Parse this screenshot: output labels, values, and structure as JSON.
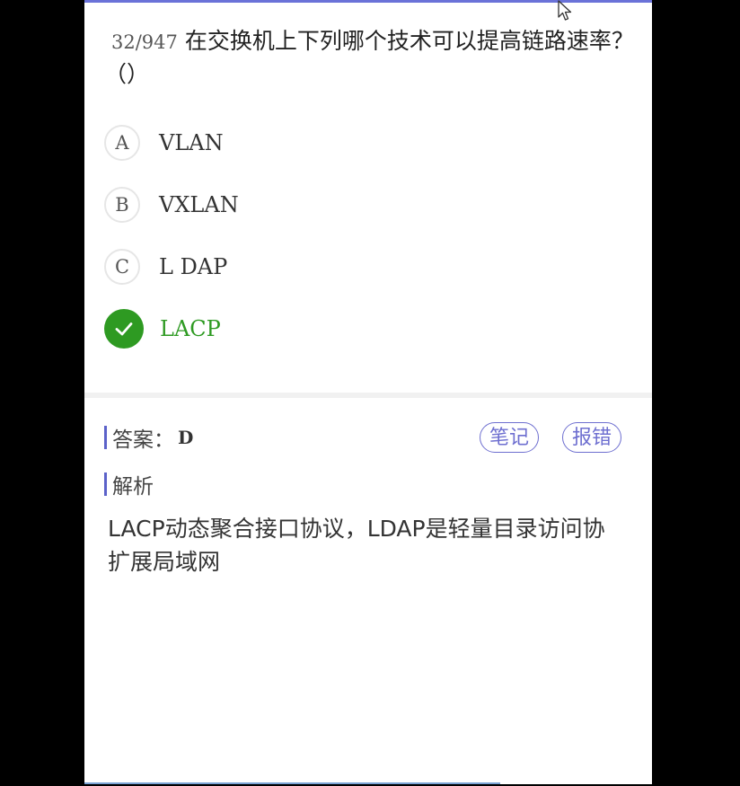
{
  "question": {
    "number": "32/947",
    "text": "在交换机上下列哪个技术可以提高链路速率？（）"
  },
  "options": [
    {
      "letter": "A",
      "text": "VLAN"
    },
    {
      "letter": "B",
      "text": "VXLAN"
    },
    {
      "letter": "C",
      "text": "L DAP"
    },
    {
      "letter": "D",
      "text": "LACP",
      "correct": true,
      "icon": "check-icon"
    }
  ],
  "answer": {
    "label": "答案：",
    "value": "D"
  },
  "buttons": {
    "notes": "笔记",
    "report": "报错"
  },
  "analysis": {
    "label": "解析",
    "line1": "LACP动态聚合接口协议，LDAP是轻量目录访问协",
    "line2": "扩展局域网"
  },
  "colors": {
    "correct": "#2e9a22",
    "accent": "#6e6fd0"
  }
}
